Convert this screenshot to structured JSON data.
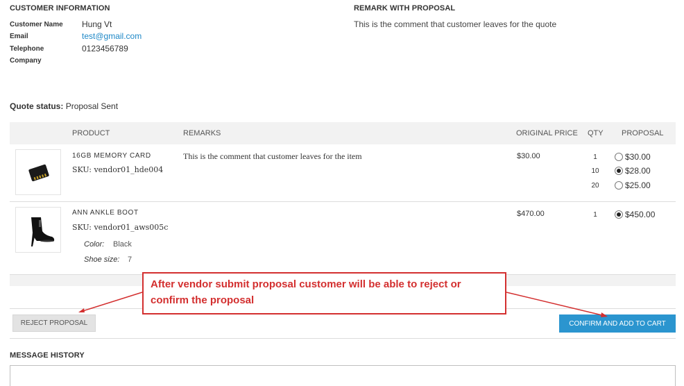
{
  "customer": {
    "title": "CUSTOMER INFORMATION",
    "name_label": "Customer Name",
    "name": "Hung Vt",
    "email_label": "Email",
    "email": "test@gmail.com",
    "phone_label": "Telephone",
    "phone": "0123456789",
    "company_label": "Company",
    "company": ""
  },
  "remark": {
    "title": "REMARK WITH PROPOSAL",
    "text": "This is the comment that customer leaves for the quote"
  },
  "quote_status": {
    "label": "Quote status:",
    "value": "Proposal Sent"
  },
  "table": {
    "headers": {
      "product": "PRODUCT",
      "remarks": "REMARKS",
      "original_price": "ORIGINAL PRICE",
      "qty": "QTY",
      "proposal": "PROPOSAL"
    },
    "rows": [
      {
        "name": "16GB MEMORY CARD",
        "sku": "SKU: vendor01_hde004",
        "remark": "This is the comment that customer leaves for the item",
        "price": "$30.00",
        "tiers": [
          {
            "qty": "1",
            "proposal": "$30.00",
            "selected": false
          },
          {
            "qty": "10",
            "proposal": "$28.00",
            "selected": true
          },
          {
            "qty": "20",
            "proposal": "$25.00",
            "selected": false
          }
        ]
      },
      {
        "name": "ANN ANKLE BOOT",
        "sku": "SKU: vendor01_aws005c",
        "remark": "",
        "price": "$470.00",
        "options": [
          {
            "label": "Color:",
            "value": "Black"
          },
          {
            "label": "Shoe size:",
            "value": "7"
          }
        ],
        "tiers": [
          {
            "qty": "1",
            "proposal": "$450.00",
            "selected": true
          }
        ]
      }
    ]
  },
  "annotation": {
    "text": "After vendor submit proposal customer will be able to reject or confirm the proposal",
    "color": "#d32f2f"
  },
  "buttons": {
    "reject": "REJECT PROPOSAL",
    "confirm": "CONFIRM AND ADD TO CART"
  },
  "message_history": {
    "title": "MESSAGE HISTORY"
  },
  "colors": {
    "accent": "#2b95cf",
    "link": "#1e88c7"
  }
}
